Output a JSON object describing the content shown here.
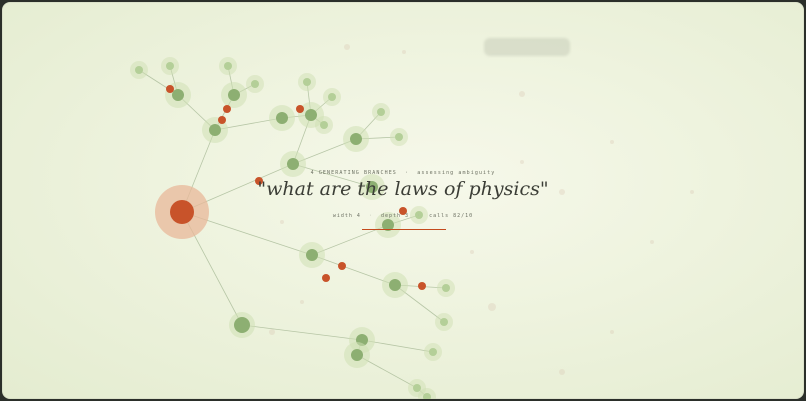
{
  "status": {
    "branches_text": "4 GENERATING BRANCHES",
    "separator": "·",
    "state_text": "assessing ambiguity"
  },
  "query": "\"what are the laws of physics\"",
  "meta": {
    "width_text": "width 4",
    "depth_text": "depth 3",
    "calls_text": "calls 82/10",
    "separator": "·"
  },
  "colors": {
    "background": "#eef3de",
    "node_green": "#8daf72",
    "node_halo": "#cfe0b4",
    "node_light": "#b4cf98",
    "node_orange": "#c8532a",
    "root_halo": "#e8b89a",
    "edge": "#a9bb98",
    "text": "#3b3d36"
  }
}
